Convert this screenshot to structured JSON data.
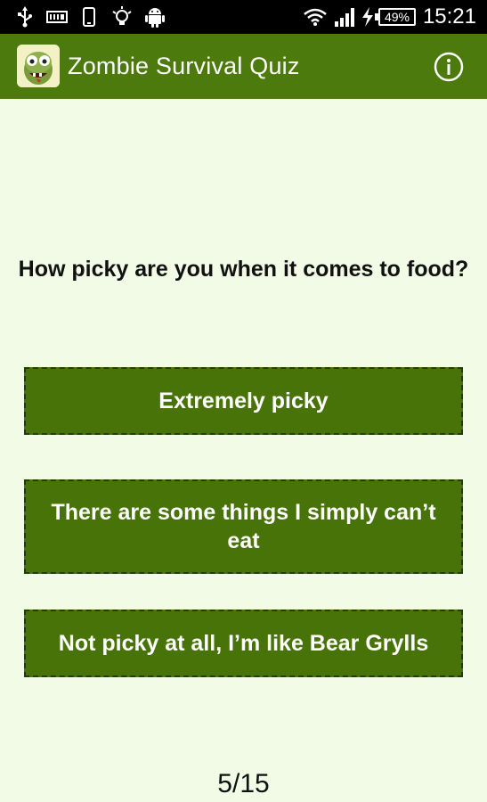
{
  "status_bar": {
    "time": "15:21",
    "battery": "49%",
    "icons": [
      "usb-icon",
      "sd-card-icon",
      "phone-icon",
      "lightbulb-icon",
      "android-icon",
      "wifi-icon",
      "signal-icon",
      "charging-icon",
      "battery-icon"
    ]
  },
  "app_bar": {
    "title": "Zombie Survival Quiz",
    "logo": "zombie-logo",
    "info_icon": "info-icon",
    "background_color": "#4c7a0c"
  },
  "quiz": {
    "question": "How picky are you when it comes to food?",
    "answers": [
      "Extremely picky",
      "There are some things I simply can’t eat",
      "Not picky at all, I’m like Bear Grylls"
    ],
    "progress": "5/15",
    "answer_color": "#477308"
  }
}
